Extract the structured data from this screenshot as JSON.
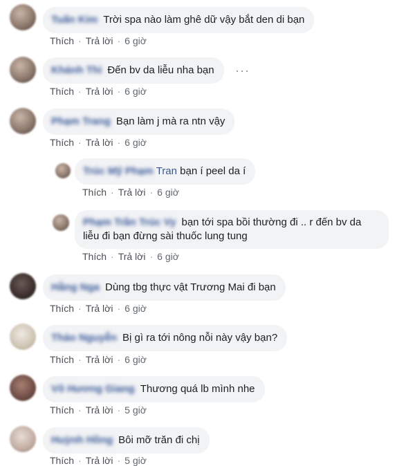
{
  "actions": {
    "like": "Thích",
    "reply": "Trả lời",
    "dot": "·"
  },
  "more_glyph": "···",
  "comments": [
    {
      "author": "Tuấn Kim",
      "text": "Trời spa nào làm ghê dữ vậy bắt den di bạn",
      "time": "6 giờ"
    },
    {
      "author": "Khánh Thi",
      "text": "Đến bv da liễu nha bạn",
      "time": "6 giờ"
    },
    {
      "author": "Phạm Trang",
      "text": "Bạn làm j mà ra ntn vậy",
      "time": "6 giờ"
    },
    {
      "author": "Trúc Mỹ Phạm",
      "mention": "Tran",
      "text": "bạn í peel da í",
      "time": "6 giờ"
    },
    {
      "author": "Phạm Trần Trúc Vy",
      "text": "bạn tới spa bồi thường đi .. r đến bv da liễu đi bạn đừng sài thuốc lung tung",
      "time": "6 giờ"
    },
    {
      "author": "Hằng Nga",
      "text": "Dùng tbg thực vật Trương Mai đi bạn",
      "time": "6 giờ"
    },
    {
      "author": "Thảo Nguyễn",
      "text": "Bị gì ra tới nông nỗi này vậy bạn?",
      "time": "6 giờ"
    },
    {
      "author": "Võ Hương Giang",
      "text": "Thương quá lb mình nhe",
      "time": "5 giờ"
    },
    {
      "author": "Huỳnh Hồng",
      "text": "Bôi mỡ trăn đi chị",
      "time": "5 giờ"
    }
  ]
}
